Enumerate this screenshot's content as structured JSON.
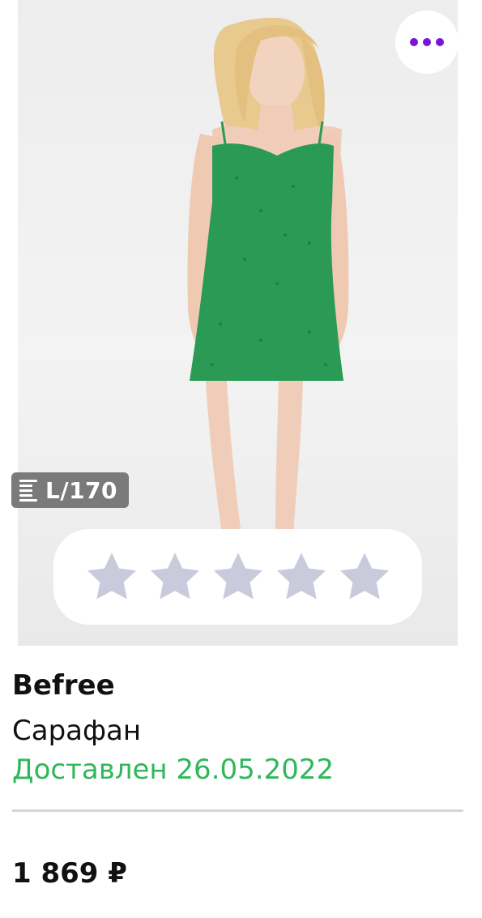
{
  "product": {
    "brand": "Befree",
    "name": "Сарафан",
    "delivery_status": "Доставлен 26.05.2022",
    "price": "1 869 ₽",
    "size_badge": "L/170"
  },
  "rating": {
    "stars_total": 5,
    "stars_filled": 0,
    "star_color": "#c9cadb"
  },
  "colors": {
    "accent": "#7b14d6",
    "delivered": "#2fb85a",
    "dress": "#2a9a55"
  },
  "icons": {
    "more": "more-horizontal-icon",
    "size": "size-chart-icon",
    "star": "star-icon"
  }
}
